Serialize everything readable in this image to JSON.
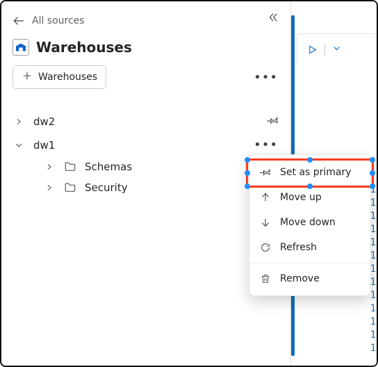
{
  "header": {
    "back_label": "All sources",
    "title": "Warehouses"
  },
  "toolbar": {
    "add_label": "Warehouses"
  },
  "tree": {
    "items": [
      {
        "label": "dw2",
        "expanded": false
      },
      {
        "label": "dw1",
        "expanded": true,
        "children": [
          {
            "label": "Schemas"
          },
          {
            "label": "Security"
          }
        ]
      }
    ]
  },
  "context_menu": {
    "items": [
      {
        "icon": "pin-icon",
        "label": "Set as primary"
      },
      {
        "icon": "arrow-up-icon",
        "label": "Move up"
      },
      {
        "icon": "arrow-down-icon",
        "label": "Move down"
      },
      {
        "icon": "refresh-icon",
        "label": "Refresh"
      },
      {
        "icon": "trash-icon",
        "label": "Remove"
      }
    ]
  },
  "editor": {
    "line_numbers": [
      "1",
      "1",
      "1",
      "1",
      "1",
      "1",
      "1",
      "1",
      "1",
      "1",
      "1",
      "1",
      "1"
    ]
  }
}
